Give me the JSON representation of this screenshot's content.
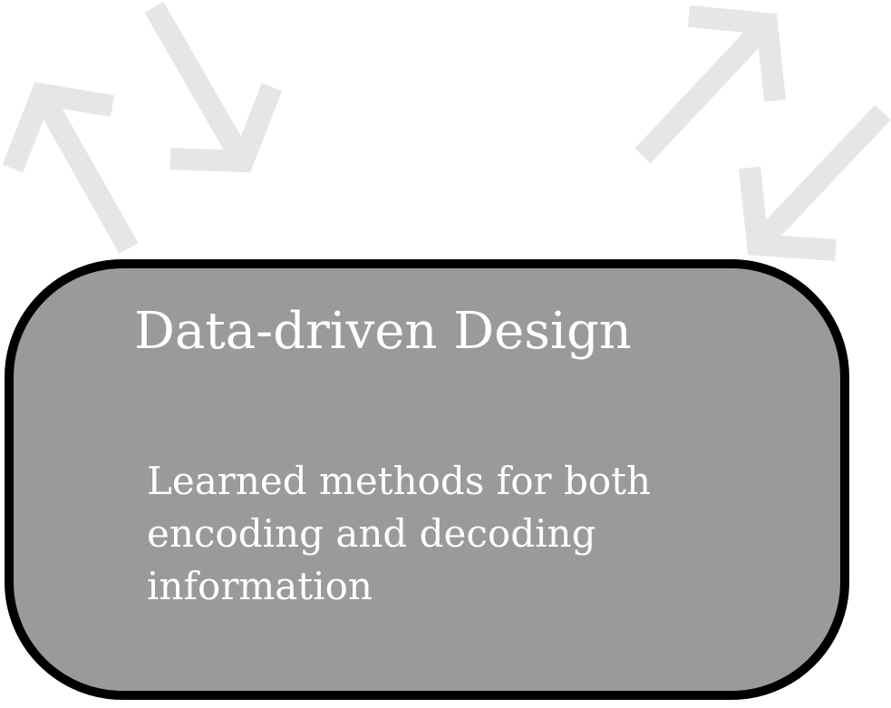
{
  "colors": {
    "background": "#ffffff",
    "card_fill": "#9a9a9a",
    "card_border": "#000000",
    "text": "#ffffff",
    "arrow": "#e6e6e6"
  },
  "arrows": [
    {
      "name": "arrow-up-left-icon",
      "direction": "up-left"
    },
    {
      "name": "arrow-down-right-icon",
      "direction": "down-right"
    },
    {
      "name": "arrow-up-right-icon",
      "direction": "up-right"
    },
    {
      "name": "arrow-down-left-icon",
      "direction": "down-left"
    }
  ],
  "card": {
    "title": "Data-driven Design",
    "description": "Learned methods for both encoding and decoding information"
  }
}
